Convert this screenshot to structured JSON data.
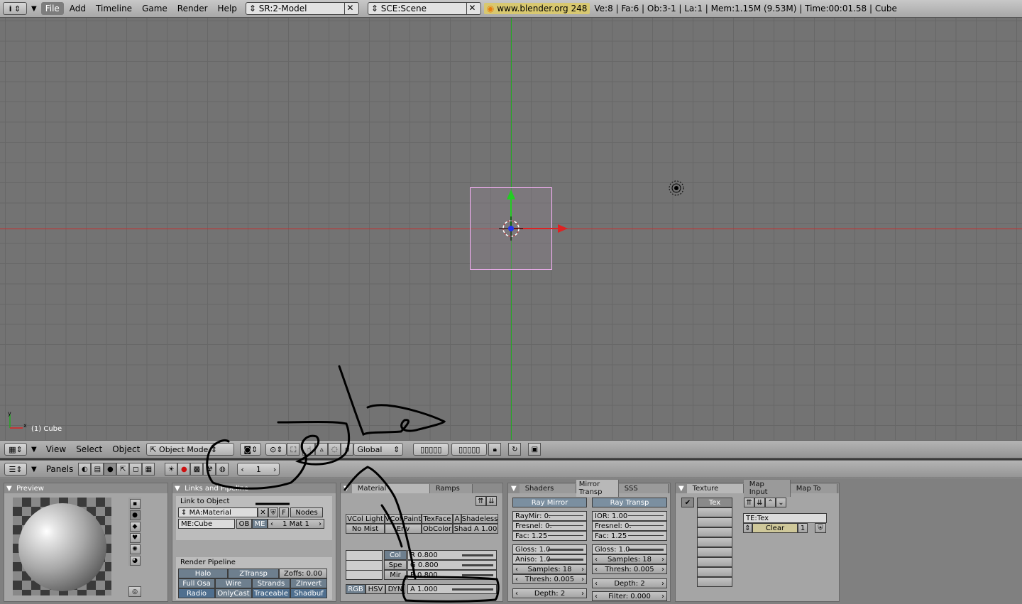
{
  "topbar": {
    "info_icon": "i",
    "menus": [
      "File",
      "Add",
      "Timeline",
      "Game",
      "Render",
      "Help"
    ],
    "screen": "SR:2-Model",
    "scene": "SCE:Scene",
    "url": "www.blender.org 248",
    "stats": "Ve:8 | Fa:6 | Ob:3-1 | La:1  | Mem:1.15M (9.53M)  | Time:00:01.58 | Cube"
  },
  "viewport": {
    "object_label": "(1) Cube",
    "colors": {
      "background": "#737373",
      "grid": "#676767",
      "x_axis": "#cc2a2a",
      "y_axis": "#22aa22",
      "selection": "#ffb6ff"
    }
  },
  "header3d": {
    "menus": [
      "View",
      "Select",
      "Object"
    ],
    "mode": "Object Mode",
    "orientation": "Global"
  },
  "buttons_header": {
    "panels_label": "Panels",
    "frame": "1"
  },
  "preview": {
    "title": "Preview"
  },
  "links": {
    "title": "Links and Pipeline",
    "link_to_object": "Link to Object",
    "material": "MA:Material",
    "f_label": "F",
    "nodes": "Nodes",
    "mesh": "ME:Cube",
    "ob": "OB",
    "me": "ME",
    "mat_index": "1 Mat 1",
    "render_pipeline": "Render Pipeline",
    "row1": [
      "Halo",
      "ZTransp",
      "Zoffs: 0.00"
    ],
    "row2": [
      "Full Osa",
      "Wire",
      "Strands",
      "ZInvert"
    ],
    "row3": [
      "Radio",
      "OnlyCast",
      "Traceable",
      "Shadbuf"
    ]
  },
  "material": {
    "tabs": [
      "Material",
      "Ramps"
    ],
    "flags_row1": [
      "VCol Light",
      "VCol Paint",
      "TexFace",
      "A",
      "Shadeless"
    ],
    "flags_row2": [
      "No Mist",
      "Env",
      "ObColor",
      "Shad A 1.00"
    ],
    "col_labels": [
      "Col",
      "Spe",
      "Mir"
    ],
    "sliders": [
      "R 0.800",
      "G 0.800",
      "B 0.800"
    ],
    "modes": [
      "RGB",
      "HSV",
      "DYN"
    ],
    "alpha": "A 1.000"
  },
  "shaders": {
    "tabs": [
      "Shaders",
      "Mirror Transp",
      "SSS"
    ],
    "ray_mirror": "Ray Mirror",
    "ray_transp": "Ray Transp",
    "left": [
      "RayMir: 0.",
      "Fresnel: 0.",
      "Fac: 1.25",
      "Gloss: 1.0",
      "Aniso: 1.0",
      "Samples: 18",
      "Thresh: 0.005",
      "Depth: 2"
    ],
    "right": [
      "IOR: 1.00",
      "Fresnel: 0.",
      "Fac: 1.25",
      "Gloss: 1.0",
      "Samples: 18",
      "Thresh: 0.005",
      "Depth: 2",
      "Filter: 0.000"
    ]
  },
  "texture": {
    "tabs": [
      "Texture",
      "Map Input",
      "Map To"
    ],
    "slot": "Tex",
    "name": "TE:Tex",
    "clear": "Clear",
    "users": "1"
  }
}
